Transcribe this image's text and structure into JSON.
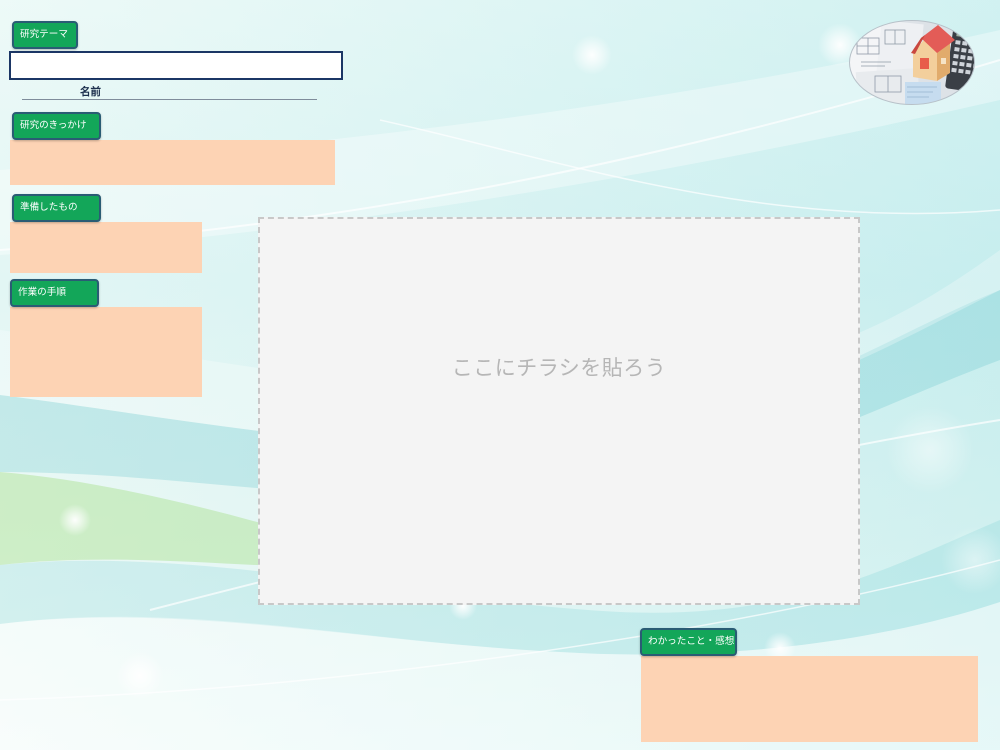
{
  "theme": {
    "label": "研究テーマ",
    "value": ""
  },
  "name": {
    "label": "名前"
  },
  "motivation": {
    "label": "研究のきっかけ",
    "value": ""
  },
  "materials": {
    "label": "準備したもの",
    "value": ""
  },
  "procedure": {
    "label": "作業の手順",
    "value": ""
  },
  "findings": {
    "label": "わかったこと・感想",
    "value": ""
  },
  "flyer": {
    "placeholder": "ここにチラシを貼ろう"
  },
  "images": {
    "top_right": "house-and-calculator-photo"
  },
  "colors": {
    "label_green": "#13a659",
    "label_border": "#2a5c74",
    "field_peach": "#fdd3b4",
    "input_border": "#1b3665",
    "drop_fill": "#f4f4f4",
    "drop_border": "#c8c8c8",
    "placeholder_text": "#b6b6b6",
    "background": "#dff5f2"
  }
}
